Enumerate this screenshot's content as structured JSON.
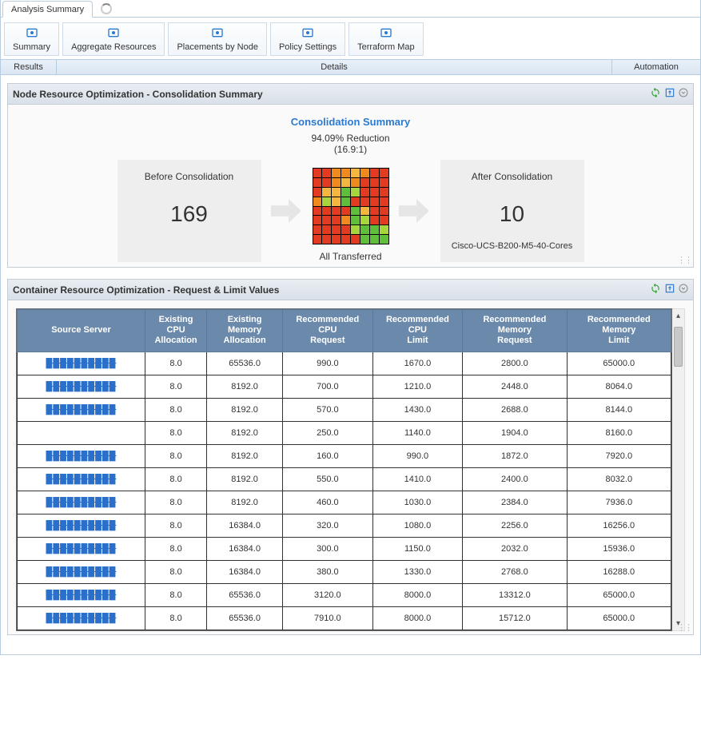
{
  "tabs": {
    "active": "Analysis Summary"
  },
  "toolbar": [
    {
      "label": "Summary"
    },
    {
      "label": "Aggregate Resources"
    },
    {
      "label": "Placements by Node"
    },
    {
      "label": "Policy Settings"
    },
    {
      "label": "Terraform Map"
    }
  ],
  "nav": [
    {
      "label": "Results"
    },
    {
      "label": "Details"
    },
    {
      "label": "Automation"
    }
  ],
  "panel1": {
    "title": "Node Resource Optimization - Consolidation Summary",
    "mid_title": "Consolidation Summary",
    "reduction": "94.09% Reduction",
    "ratio": "(16.9:1)",
    "transferred": "All Transferred",
    "before": {
      "title": "Before Consolidation",
      "value": "169"
    },
    "after": {
      "title": "After Consolidation",
      "value": "10",
      "hw": "Cisco-UCS-B200-M5-40-Cores"
    }
  },
  "panel2": {
    "title": "Container Resource Optimization - Request & Limit Values",
    "columns": [
      "Source Server",
      "Existing CPU Allocation",
      "Existing Memory Allocation",
      "Recommended CPU Request",
      "Recommended CPU Limit",
      "Recommended Memory Request",
      "Recommended Memory Limit"
    ],
    "rows": [
      [
        "██████████",
        "8.0",
        "65536.0",
        "990.0",
        "1670.0",
        "2800.0",
        "65000.0"
      ],
      [
        "██████████",
        "8.0",
        "8192.0",
        "700.0",
        "1210.0",
        "2448.0",
        "8064.0"
      ],
      [
        "██████████",
        "8.0",
        "8192.0",
        "570.0",
        "1430.0",
        "2688.0",
        "8144.0"
      ],
      [
        "",
        "8.0",
        "8192.0",
        "250.0",
        "1140.0",
        "1904.0",
        "8160.0"
      ],
      [
        "██████████",
        "8.0",
        "8192.0",
        "160.0",
        "990.0",
        "1872.0",
        "7920.0"
      ],
      [
        "██████████",
        "8.0",
        "8192.0",
        "550.0",
        "1410.0",
        "2400.0",
        "8032.0"
      ],
      [
        "██████████",
        "8.0",
        "8192.0",
        "460.0",
        "1030.0",
        "2384.0",
        "7936.0"
      ],
      [
        "██████████",
        "8.0",
        "16384.0",
        "320.0",
        "1080.0",
        "2256.0",
        "16256.0"
      ],
      [
        "██████████",
        "8.0",
        "16384.0",
        "300.0",
        "1150.0",
        "2032.0",
        "15936.0"
      ],
      [
        "██████████",
        "8.0",
        "16384.0",
        "380.0",
        "1330.0",
        "2768.0",
        "16288.0"
      ],
      [
        "██████████",
        "8.0",
        "65536.0",
        "3120.0",
        "8000.0",
        "13312.0",
        "65000.0"
      ],
      [
        "██████████",
        "8.0",
        "65536.0",
        "7910.0",
        "8000.0",
        "15712.0",
        "65000.0"
      ]
    ]
  },
  "heatmap_colors": [
    "#e23b22",
    "#e23b22",
    "#f08a1f",
    "#f08a1f",
    "#f4b63e",
    "#f08a1f",
    "#e23b22",
    "#e23b22",
    "#e23b22",
    "#e23b22",
    "#f08a1f",
    "#f4b63e",
    "#f08a1f",
    "#e23b22",
    "#e23b22",
    "#e23b22",
    "#e23b22",
    "#f4b63e",
    "#f4b63e",
    "#5fbf3a",
    "#a6d63c",
    "#e23b22",
    "#e23b22",
    "#e23b22",
    "#f08a1f",
    "#a6d63c",
    "#f4b63e",
    "#5fbf3a",
    "#e23b22",
    "#e23b22",
    "#e23b22",
    "#e23b22",
    "#e23b22",
    "#e23b22",
    "#e23b22",
    "#e23b22",
    "#5fbf3a",
    "#f4b63e",
    "#e23b22",
    "#e23b22",
    "#e23b22",
    "#e23b22",
    "#e23b22",
    "#f08a1f",
    "#5fbf3a",
    "#a6d63c",
    "#e23b22",
    "#e23b22",
    "#e23b22",
    "#e23b22",
    "#e23b22",
    "#e23b22",
    "#a6d63c",
    "#5fbf3a",
    "#5fbf3a",
    "#a6d63c",
    "#e23b22",
    "#e23b22",
    "#e23b22",
    "#e23b22",
    "#e23b22",
    "#5fbf3a",
    "#5fbf3a",
    "#5fbf3a"
  ]
}
